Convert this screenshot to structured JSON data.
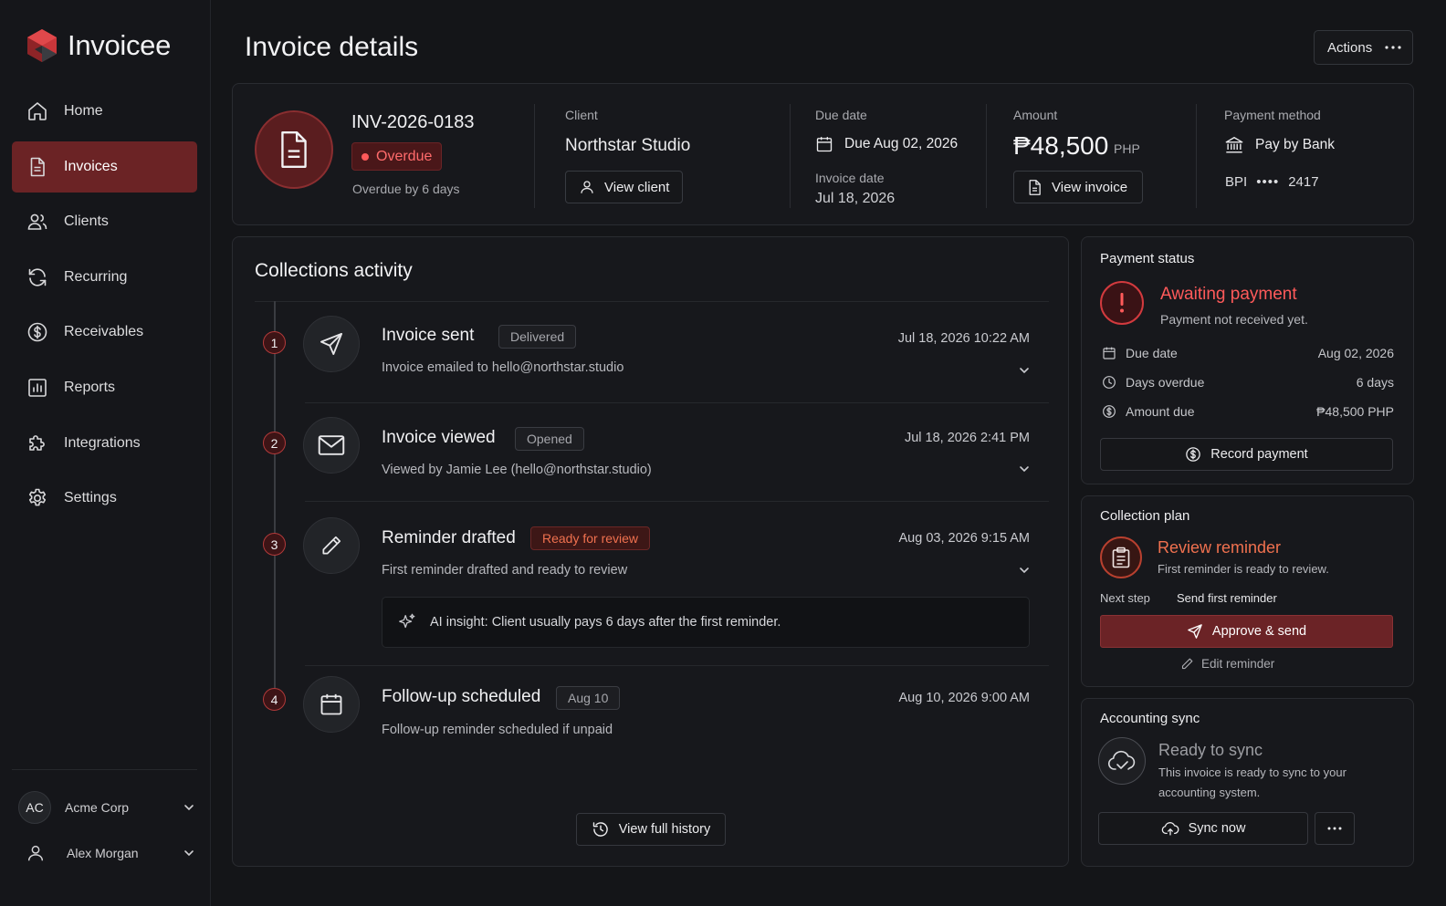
{
  "app": {
    "name": "Invoicee"
  },
  "sidebar": {
    "items": [
      {
        "label": "Home",
        "icon": "home-icon",
        "active": false
      },
      {
        "label": "Invoices",
        "icon": "file-icon",
        "active": true
      },
      {
        "label": "Clients",
        "icon": "users-icon",
        "active": false
      },
      {
        "label": "Recurring",
        "icon": "refresh-icon",
        "active": false
      },
      {
        "label": "Receivables",
        "icon": "dollar-icon",
        "active": false
      },
      {
        "label": "Reports",
        "icon": "bar-chart-icon",
        "active": false
      },
      {
        "label": "Integrations",
        "icon": "puzzle-icon",
        "active": false
      },
      {
        "label": "Settings",
        "icon": "gear-icon",
        "active": false
      }
    ],
    "org": {
      "initials": "AC",
      "name": "Acme Corp"
    },
    "user": {
      "name": "Alex Morgan"
    }
  },
  "header": {
    "title": "Invoice details",
    "actions_label": "Actions"
  },
  "summary": {
    "invoice_number": "INV-2026-0183",
    "status": "Overdue",
    "overdue_by": "Overdue by 6 days",
    "client_label": "Client",
    "client_name": "Northstar Studio",
    "view_client": "View client",
    "due_label": "Due date",
    "due_value": "Due Aug 02, 2026",
    "invoice_date_label": "Invoice date",
    "invoice_date": "Jul 18, 2026",
    "amount_label": "Amount",
    "amount": "₱48,500",
    "currency": "PHP",
    "view_invoice": "View invoice",
    "payment_method_label": "Payment method",
    "payment_method": "Pay by Bank",
    "bank": "BPI",
    "account_mask": "••••",
    "account_last4": "2417"
  },
  "collections": {
    "title": "Collections activity",
    "events": [
      {
        "num": "1",
        "title": "Invoice sent",
        "badge": "Delivered",
        "desc": "Invoice emailed to hello@northstar.studio",
        "time": "Jul 18, 2026 10:22 AM"
      },
      {
        "num": "2",
        "title": "Invoice viewed",
        "badge": "Opened",
        "desc": "Viewed by Jamie Lee (hello@northstar.studio)",
        "time": "Jul 18, 2026  2:41 PM"
      },
      {
        "num": "3",
        "title": "Reminder drafted",
        "badge": "Ready for review",
        "desc": "First reminder drafted and ready to review",
        "time": "Aug 03, 2026  9:15 AM"
      },
      {
        "num": "4",
        "title": "Follow-up scheduled",
        "badge": "Aug 10",
        "desc": "Follow-up reminder scheduled if unpaid",
        "time": "Aug 10, 2026  9:00 AM"
      }
    ],
    "ai_insight": "AI insight: Client usually pays 6 days after the first reminder.",
    "view_history": "View full history"
  },
  "payment_status": {
    "title": "Payment status",
    "headline": "Awaiting payment",
    "sub": "Payment not received yet.",
    "rows": [
      {
        "label": "Due date",
        "value": "Aug 02, 2026"
      },
      {
        "label": "Days overdue",
        "value": "6 days"
      },
      {
        "label": "Amount due",
        "value": "₱48,500 PHP"
      }
    ],
    "record_payment": "Record payment"
  },
  "collection_plan": {
    "title": "Collection plan",
    "headline": "Review reminder",
    "sub": "First reminder is ready to review.",
    "next_step_label": "Next step",
    "next_step_value": "Send first reminder",
    "approve_label": "Approve & send",
    "edit_label": "Edit reminder"
  },
  "accounting_sync": {
    "title": "Accounting sync",
    "headline": "Ready to sync",
    "sub_line1": "This invoice is ready to sync to your",
    "sub_line2": "accounting system.",
    "sync_label": "Sync now"
  },
  "colors": {
    "accent": "#6b2325",
    "danger": "#ff5a5a",
    "warning": "#f0714f",
    "background": "#141518"
  }
}
